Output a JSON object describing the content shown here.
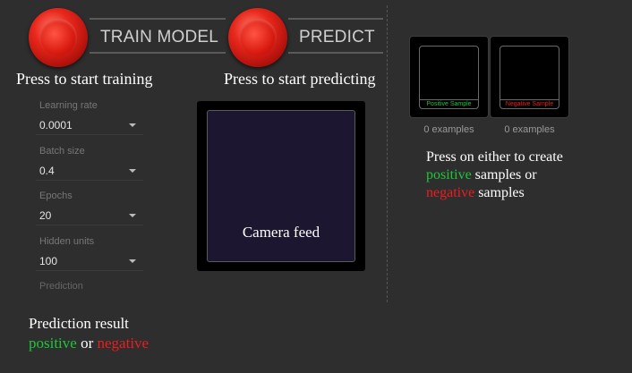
{
  "train": {
    "button_label": "TRAIN MODEL",
    "press_text": "Press to start training"
  },
  "predict": {
    "button_label": "PREDICT",
    "press_text": "Press to start predicting"
  },
  "params": [
    {
      "label": "Learning rate",
      "value": "0.0001"
    },
    {
      "label": "Batch size",
      "value": "0.4"
    },
    {
      "label": "Epochs",
      "value": "20"
    },
    {
      "label": "Hidden units",
      "value": "100"
    }
  ],
  "prediction_label": "Prediction",
  "camera": {
    "caption": "Camera feed"
  },
  "samples": {
    "positive": {
      "tag": "Positive Sample",
      "count_text": "0 examples"
    },
    "negative": {
      "tag": "Negative Sample",
      "count_text": "0 examples"
    },
    "instructions": {
      "line1": "Press on either to create",
      "positive": "positive",
      "line2": "samples or",
      "negative": "negative",
      "line3": "samples"
    }
  },
  "result": {
    "title": "Prediction result",
    "positive": "positive",
    "or": "or",
    "negative": "negative"
  },
  "colors": {
    "positive": "#1fc63a",
    "negative": "#ee1d1d",
    "accent_red": "#e8281c"
  }
}
